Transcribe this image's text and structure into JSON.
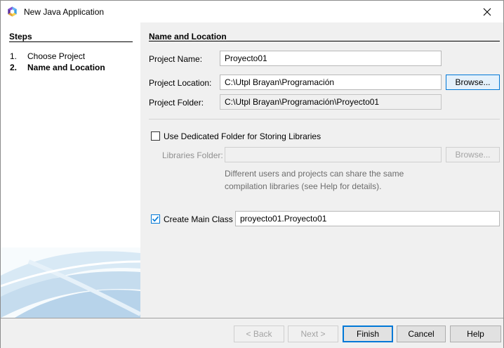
{
  "window": {
    "title": "New Java Application",
    "icon": "netbeans-icon",
    "close_glyph": "✕"
  },
  "steps": {
    "title": "Steps",
    "items": [
      {
        "number": "1.",
        "label": "Choose Project"
      },
      {
        "number": "2.",
        "label": "Name and Location"
      }
    ]
  },
  "main": {
    "section_title": "Name and Location",
    "project_name": {
      "label": "Project Name:",
      "value": "Proyecto01"
    },
    "project_location": {
      "label": "Project Location:",
      "value": "C:\\Utpl Brayan\\Programación",
      "browse_label": "Browse..."
    },
    "project_folder": {
      "label": "Project Folder:",
      "value": "C:\\Utpl Brayan\\Programación\\Proyecto01"
    },
    "dedicated_folder": {
      "label": "Use Dedicated Folder for Storing Libraries",
      "checked": false
    },
    "libraries_folder": {
      "label": "Libraries Folder:",
      "value": "",
      "browse_label": "Browse..."
    },
    "libraries_note_line1": "Different users and projects can share the same",
    "libraries_note_line2": "compilation libraries (see Help for details).",
    "main_class": {
      "label": "Create Main Class",
      "checked": true,
      "value": "proyecto01.Proyecto01"
    }
  },
  "footer": {
    "back_label": "< Back",
    "next_label": "Next >",
    "finish_label": "Finish",
    "cancel_label": "Cancel",
    "help_label": "Help"
  },
  "colors": {
    "accent": "#0078d7",
    "disabled_text": "#a3a3a3"
  }
}
